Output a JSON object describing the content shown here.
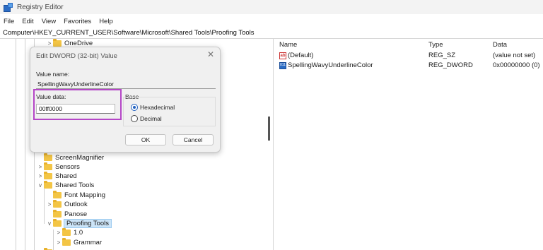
{
  "window": {
    "title": "Registry Editor",
    "icon": "registry-editor-icon"
  },
  "menu": [
    "File",
    "Edit",
    "View",
    "Favorites",
    "Help"
  ],
  "address": "Computer\\HKEY_CURRENT_USER\\Software\\Microsoft\\Shared Tools\\Proofing Tools",
  "tree": {
    "items": [
      {
        "label": "OneDrive",
        "expander": ">"
      },
      {
        "label": "ScreenMagnifier",
        "expander": ""
      },
      {
        "label": "Sensors",
        "expander": ">"
      },
      {
        "label": "Shared",
        "expander": ">"
      },
      {
        "label": "Shared Tools",
        "expander": "v"
      },
      {
        "label": "Font Mapping",
        "expander": ""
      },
      {
        "label": "Outlook",
        "expander": ">"
      },
      {
        "label": "Panose",
        "expander": ""
      },
      {
        "label": "Proofing Tools",
        "expander": "v",
        "selected": true
      },
      {
        "label": "1.0",
        "expander": ">"
      },
      {
        "label": "Grammar",
        "expander": ">"
      }
    ]
  },
  "list": {
    "columns": [
      "Name",
      "Type",
      "Data"
    ],
    "rows": [
      {
        "icon": "ab",
        "name": "(Default)",
        "type": "REG_SZ",
        "data": "(value not set)"
      },
      {
        "icon": "011",
        "name": "SpellingWavyUnderlineColor",
        "type": "REG_DWORD",
        "data": "0x00000000 (0)"
      }
    ]
  },
  "dialog": {
    "title": "Edit DWORD (32-bit) Value",
    "close_glyph": "✕",
    "value_name_label": "Value name:",
    "value_name": "SpellingWavyUnderlineColor",
    "value_data_label": "Value data:",
    "value_data": "00ff0000",
    "base_label": "Base",
    "base_options": [
      {
        "label": "Hexadecimal",
        "checked": true
      },
      {
        "label": "Decimal",
        "checked": false
      }
    ],
    "ok_label": "OK",
    "cancel_label": "Cancel"
  },
  "colors": {
    "highlight": "#b546c7",
    "radio_accent": "#1f5fbf",
    "folder": "#f3c545"
  }
}
